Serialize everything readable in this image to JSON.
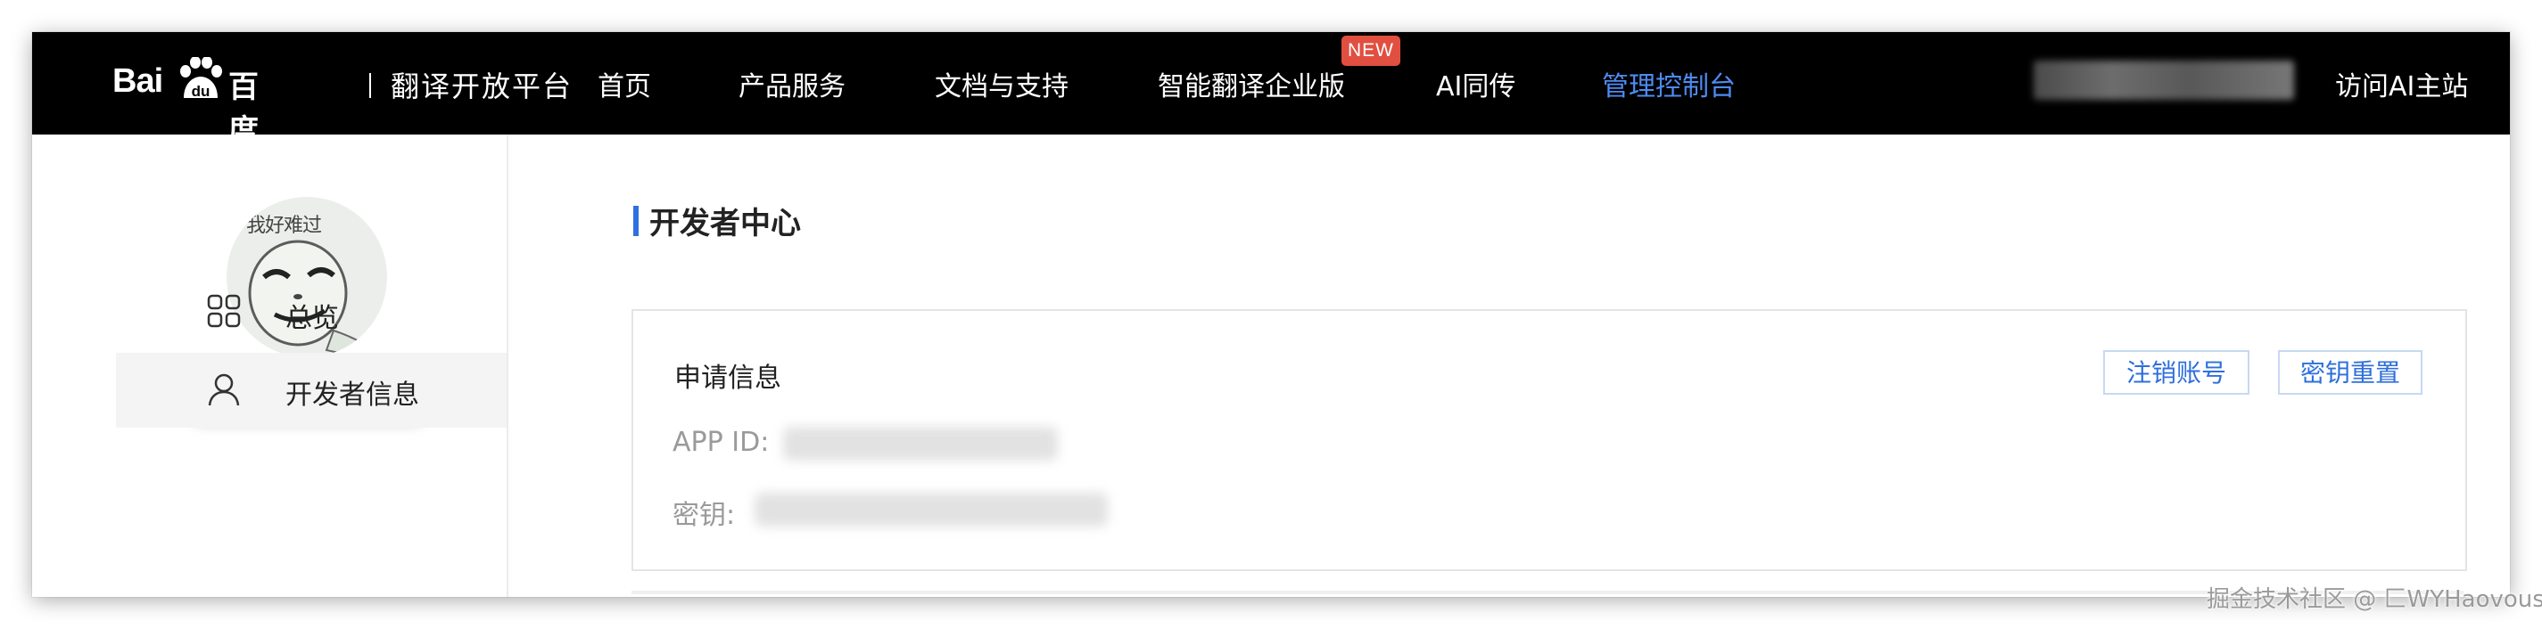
{
  "header": {
    "logo_bai": "Bai",
    "logo_du": "du",
    "logo_cn": "百度",
    "logo_divider": "|",
    "logo_sub": "翻译开放平台",
    "nav": [
      {
        "label": "首页"
      },
      {
        "label": "产品服务"
      },
      {
        "label": "文档与支持"
      },
      {
        "label": "智能翻译企业版"
      },
      {
        "label": "AI同传"
      },
      {
        "label": "管理控制台"
      }
    ],
    "new_badge": "NEW",
    "visit_ai": "访问AI主站",
    "active_color": "#4e8bf2",
    "badge_color": "#e14f40"
  },
  "sidebar": {
    "avatar_text": "我好难过",
    "items": [
      {
        "label": "总览",
        "icon": "grid-icon"
      },
      {
        "label": "开发者信息",
        "icon": "user-icon"
      }
    ]
  },
  "main": {
    "page_title": "开发者中心",
    "card": {
      "title": "申请信息",
      "cancel_button": "注销账号",
      "reset_button": "密钥重置",
      "app_id_label": "APP ID:",
      "secret_label": "密钥:"
    }
  },
  "watermark": "掘金技术社区 @ 匚WYHaovous",
  "colors": {
    "accent": "#2f70e0",
    "topbar": "#000000"
  }
}
